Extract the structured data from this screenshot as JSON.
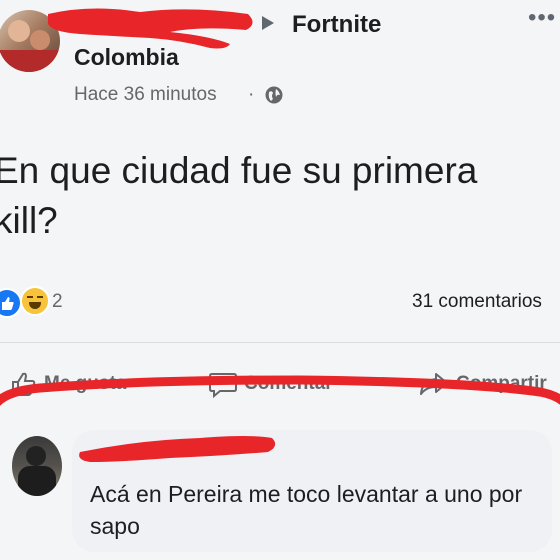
{
  "post": {
    "group": "Fortnite",
    "location": "Colombia",
    "time": "Hace 36 minutos",
    "separator": "·",
    "more": "•••",
    "text_line1": "En que ciudad fue su primera",
    "text_line2": "kill?"
  },
  "reactions": {
    "count": "2",
    "comments": "31 comentarios"
  },
  "actions": {
    "like": "Me gusta",
    "comment": "Comentar",
    "share": "Compartir"
  },
  "comment": {
    "text": "Acá en Pereira me toco levantar a uno por sapo"
  },
  "colors": {
    "marker": "#e8262a",
    "like_blue": "#1877f2",
    "haha_yellow": "#f7c33b"
  },
  "icons": [
    "globe-icon",
    "arrow-right-icon",
    "more-icon",
    "thumbs-up-icon",
    "comment-icon",
    "share-icon",
    "like-reaction-icon",
    "haha-reaction-icon"
  ]
}
